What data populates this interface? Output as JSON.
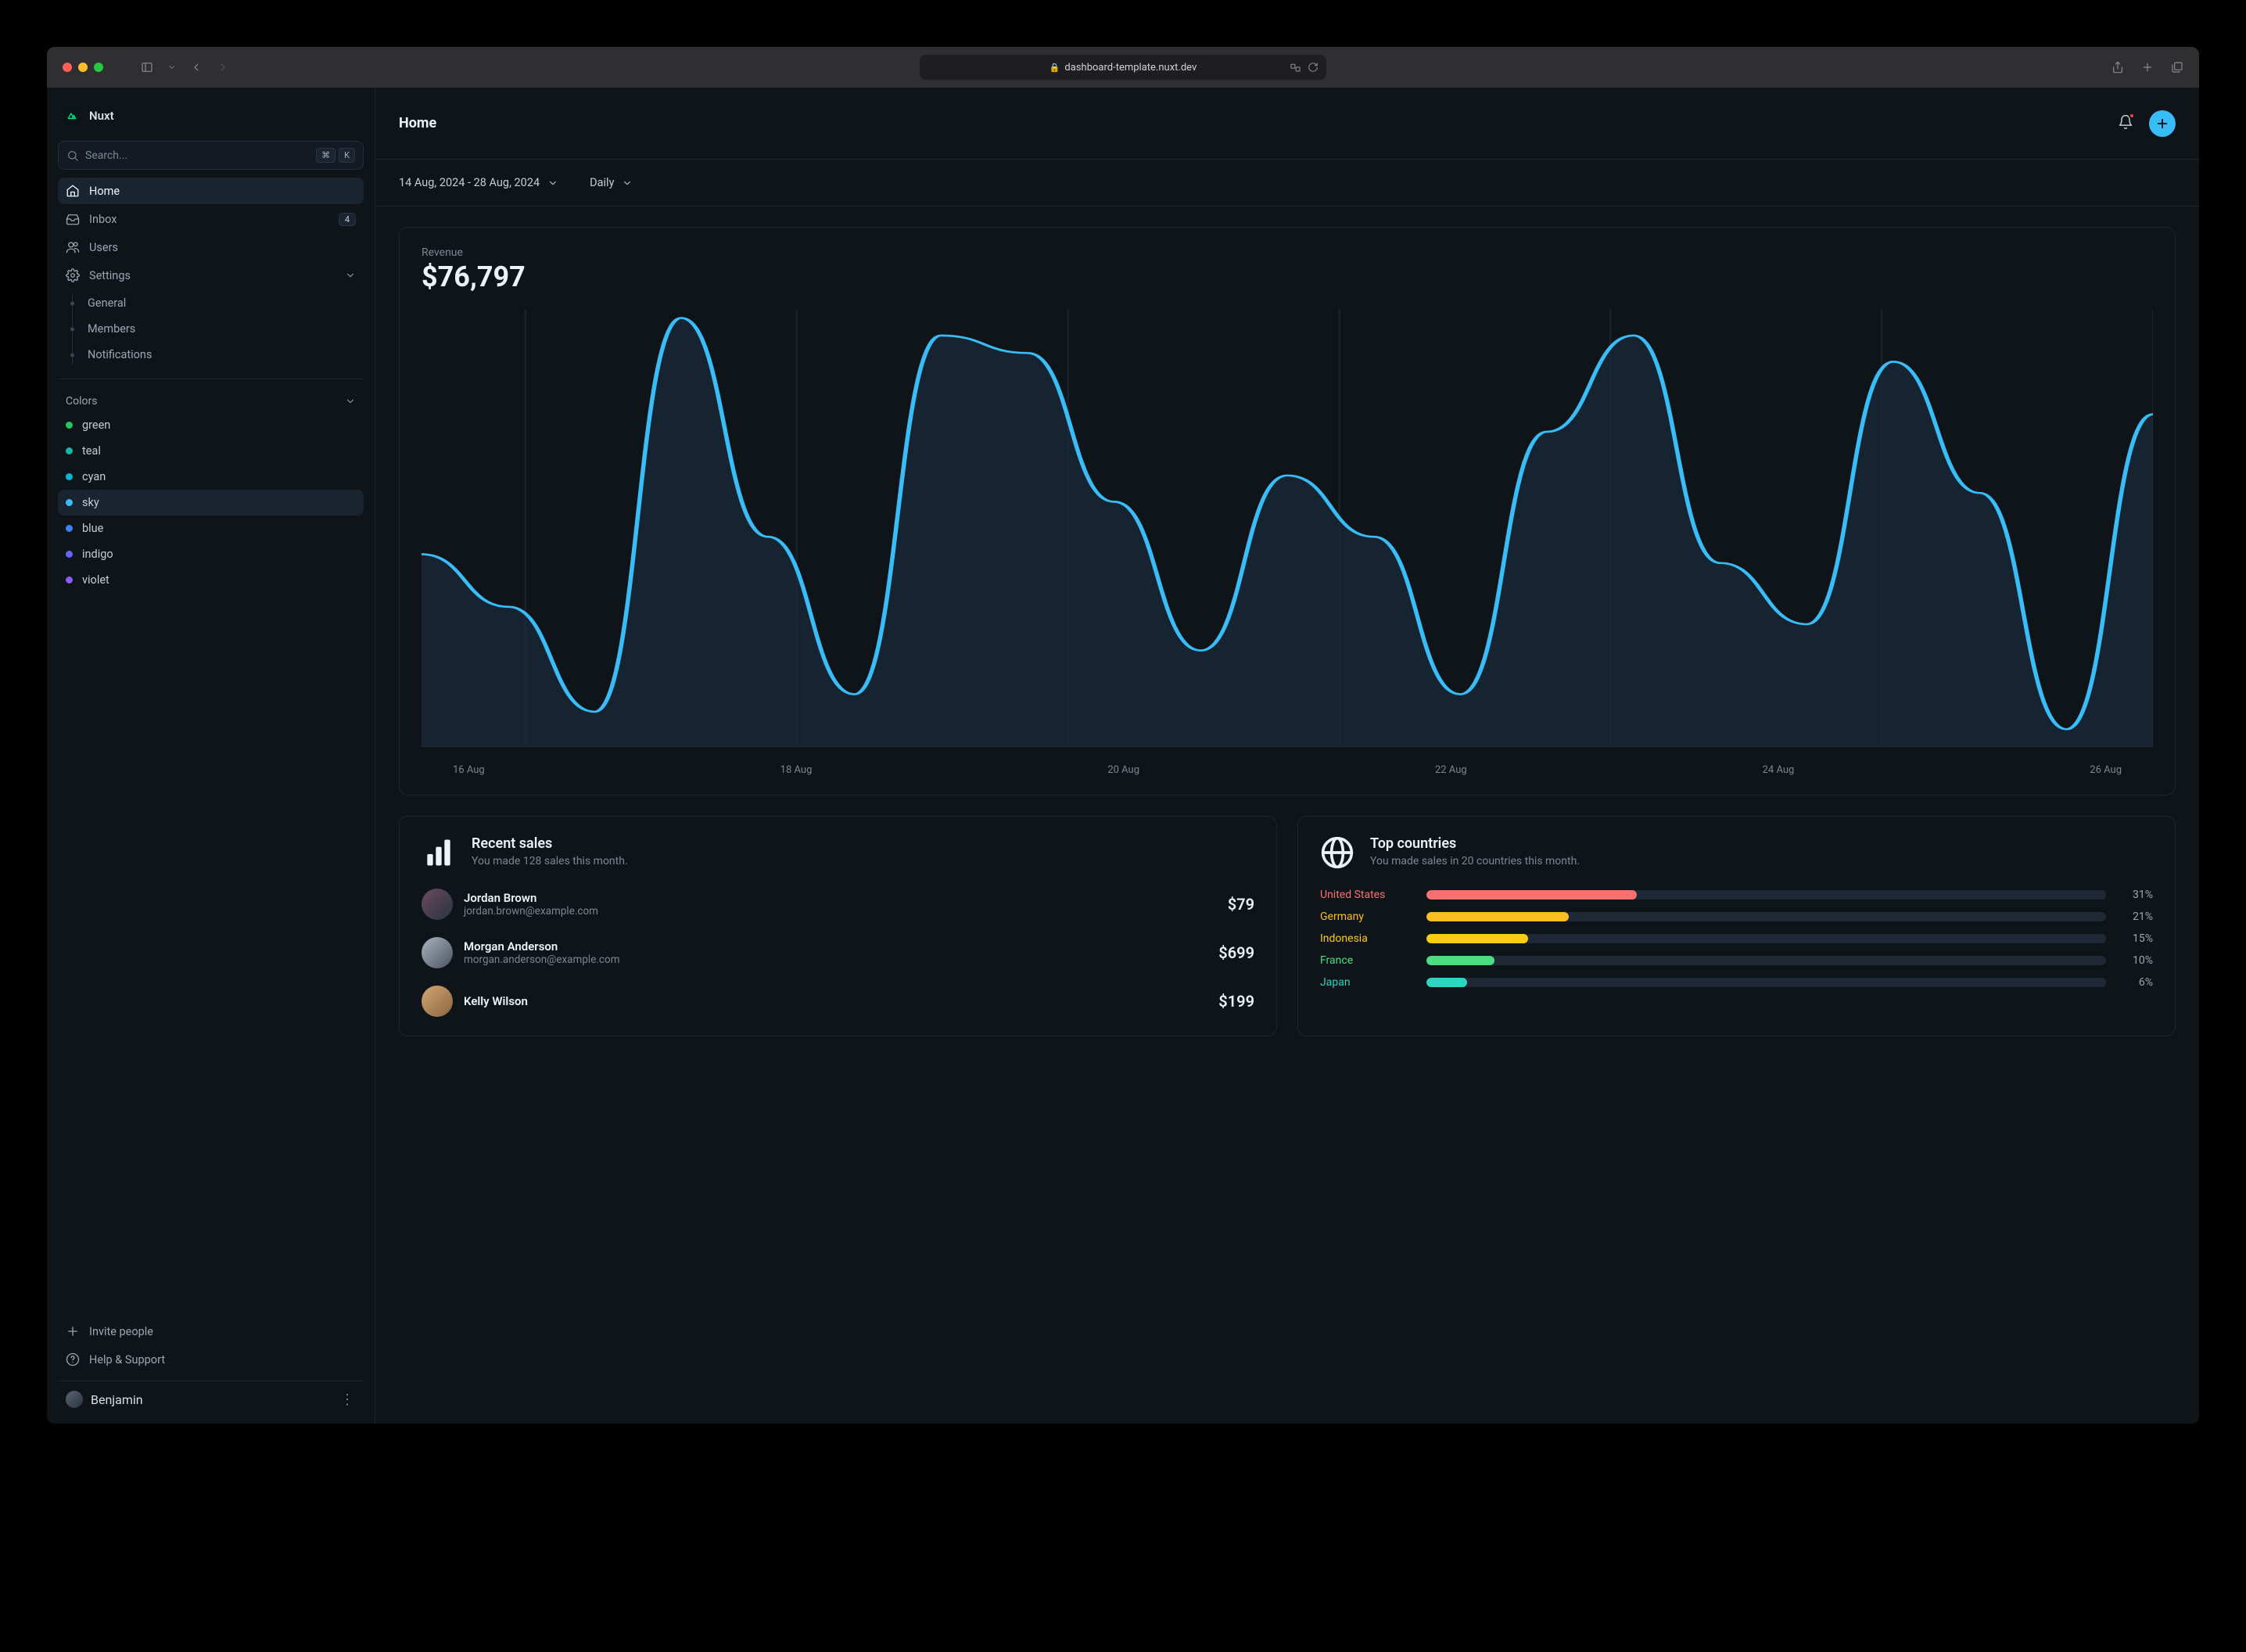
{
  "browser": {
    "url": "dashboard-template.nuxt.dev"
  },
  "logo": {
    "name": "Nuxt"
  },
  "search": {
    "placeholder": "Search...",
    "kbd1": "⌘",
    "kbd2": "K"
  },
  "nav": {
    "home": "Home",
    "inbox": "Inbox",
    "inbox_badge": "4",
    "users": "Users",
    "settings": "Settings",
    "general": "General",
    "members": "Members",
    "notifications": "Notifications"
  },
  "colors": {
    "title": "Colors",
    "items": [
      {
        "label": "green",
        "hex": "#22c55e"
      },
      {
        "label": "teal",
        "hex": "#14b8a6"
      },
      {
        "label": "cyan",
        "hex": "#06b6d4"
      },
      {
        "label": "sky",
        "hex": "#38bdf8"
      },
      {
        "label": "blue",
        "hex": "#3b82f6"
      },
      {
        "label": "indigo",
        "hex": "#6366f1"
      },
      {
        "label": "violet",
        "hex": "#8b5cf6"
      }
    ],
    "active": "sky"
  },
  "footer": {
    "invite": "Invite people",
    "help": "Help & Support",
    "user": "Benjamin"
  },
  "page": {
    "title": "Home"
  },
  "filters": {
    "range": "14 Aug, 2024 - 28 Aug, 2024",
    "granularity": "Daily"
  },
  "revenue": {
    "label": "Revenue",
    "value": "$76,797"
  },
  "chart_data": {
    "type": "area",
    "title": "Revenue",
    "xlabel": "",
    "ylabel": "",
    "categories": [
      "16 Aug",
      "18 Aug",
      "20 Aug",
      "22 Aug",
      "24 Aug",
      "26 Aug"
    ],
    "series": [
      {
        "name": "Revenue",
        "normalized_y": [
          0.44,
          0.32,
          0.08,
          0.98,
          0.48,
          0.12,
          0.94,
          0.9,
          0.56,
          0.22,
          0.62,
          0.48,
          0.12,
          0.72,
          0.94,
          0.42,
          0.28,
          0.88,
          0.58,
          0.04,
          0.76
        ]
      }
    ],
    "ylim": [
      0,
      1
    ],
    "color": "#38bdf8"
  },
  "recent_sales": {
    "title": "Recent sales",
    "subtitle": "You made 128 sales this month.",
    "items": [
      {
        "name": "Jordan Brown",
        "email": "jordan.brown@example.com",
        "amount": "$79"
      },
      {
        "name": "Morgan Anderson",
        "email": "morgan.anderson@example.com",
        "amount": "$699"
      },
      {
        "name": "Kelly Wilson",
        "email": "",
        "amount": "$199"
      }
    ]
  },
  "top_countries": {
    "title": "Top countries",
    "subtitle": "You made sales in 20 countries this month.",
    "items": [
      {
        "name": "United States",
        "pct": 31,
        "color": "#f87171"
      },
      {
        "name": "Germany",
        "pct": 21,
        "color": "#fbbf24"
      },
      {
        "name": "Indonesia",
        "pct": 15,
        "color": "#facc15"
      },
      {
        "name": "France",
        "pct": 10,
        "color": "#4ade80"
      },
      {
        "name": "Japan",
        "pct": 6,
        "color": "#2dd4bf"
      }
    ]
  }
}
